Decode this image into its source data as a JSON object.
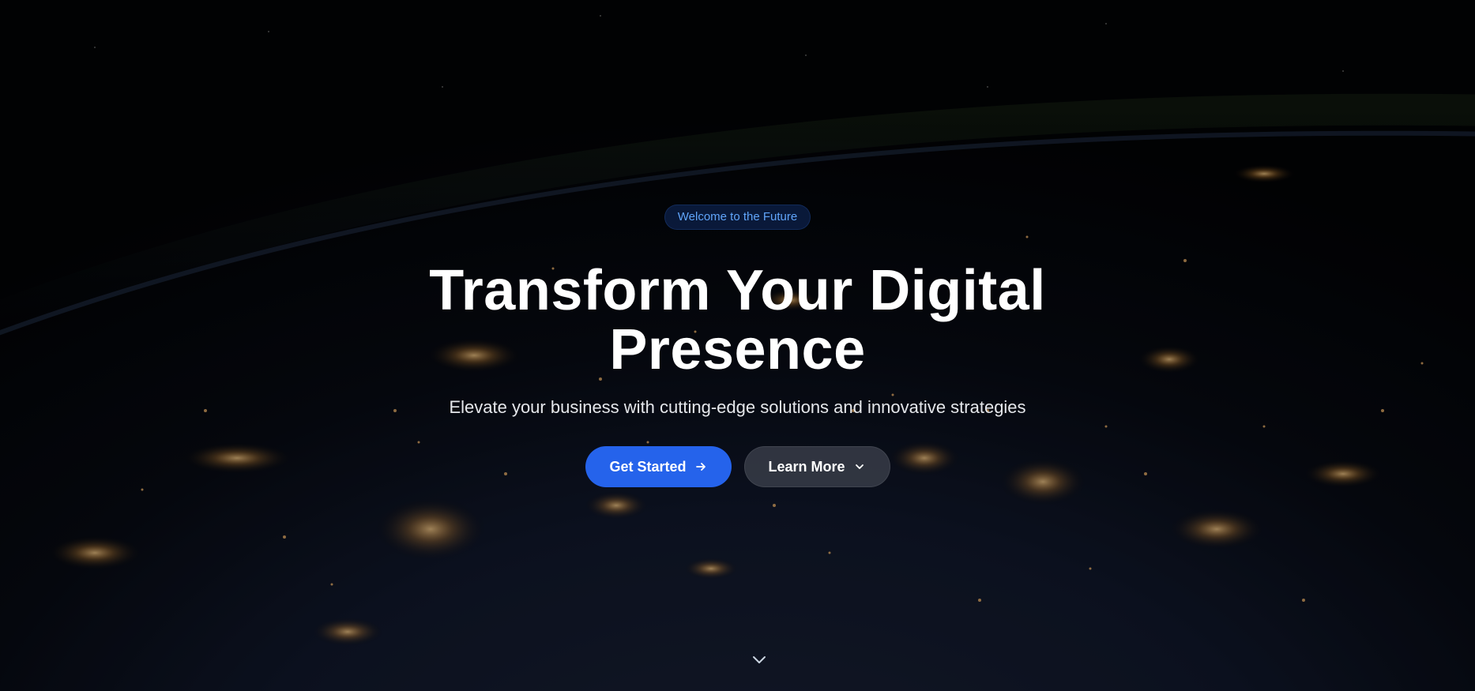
{
  "hero": {
    "badge": "Welcome to the Future",
    "title_line1": "Transform Your Digital",
    "title_line2": "Presence",
    "subtitle": "Elevate your business with cutting-edge solutions and innovative strategies"
  },
  "actions": {
    "primary_label": "Get Started",
    "primary_icon": "arrow-right-icon",
    "secondary_label": "Learn More",
    "secondary_icon": "chevron-down-icon"
  },
  "scroll": {
    "icon": "chevron-down-icon"
  },
  "colors": {
    "accent": "#2563eb",
    "badge_text": "#60a5fa",
    "background": "#05070d",
    "city_lights": "#f5b86b"
  }
}
